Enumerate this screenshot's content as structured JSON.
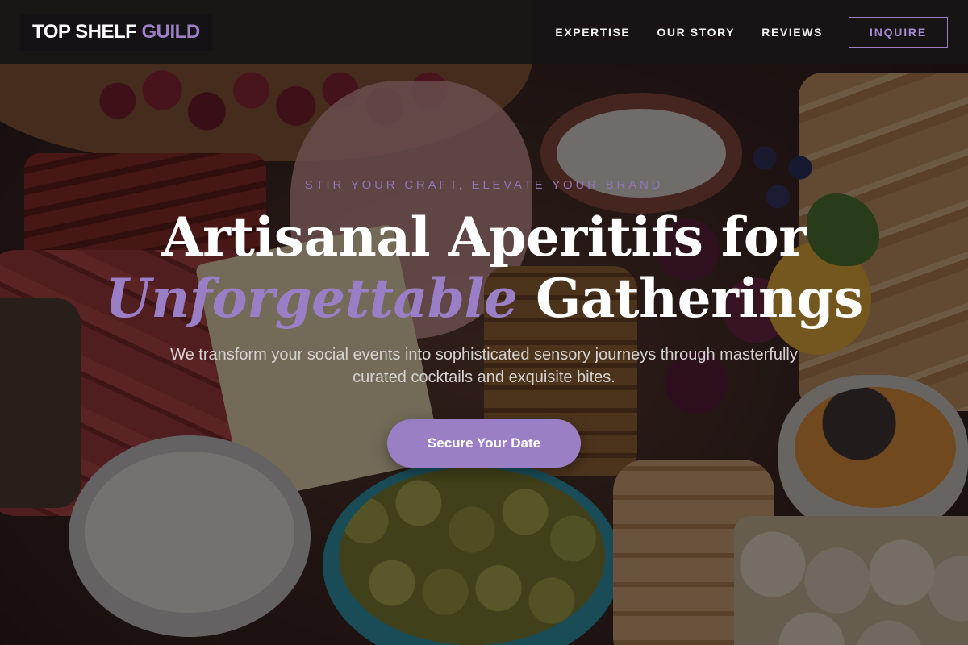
{
  "brand": {
    "logo_main": "TOP SHELF ",
    "logo_accent": "GUILD",
    "accent_color": "#9b7fc4"
  },
  "nav": {
    "items": [
      {
        "label": "EXPERTISE"
      },
      {
        "label": "OUR STORY"
      },
      {
        "label": "REVIEWS"
      }
    ],
    "inquire_label": "INQUIRE"
  },
  "hero": {
    "eyebrow": "STIR YOUR CRAFT, ELEVATE YOUR BRAND",
    "headline_line1": "Artisanal Aperitifs for",
    "headline_accent": "Unforgettable",
    "headline_line2_rest": " Gatherings",
    "subtext": "We transform your social events into sophisticated sensory journeys through masterfully curated cocktails and exquisite bites.",
    "cta_label": "Secure Your Date",
    "background": "charcuterie-board-photo"
  }
}
